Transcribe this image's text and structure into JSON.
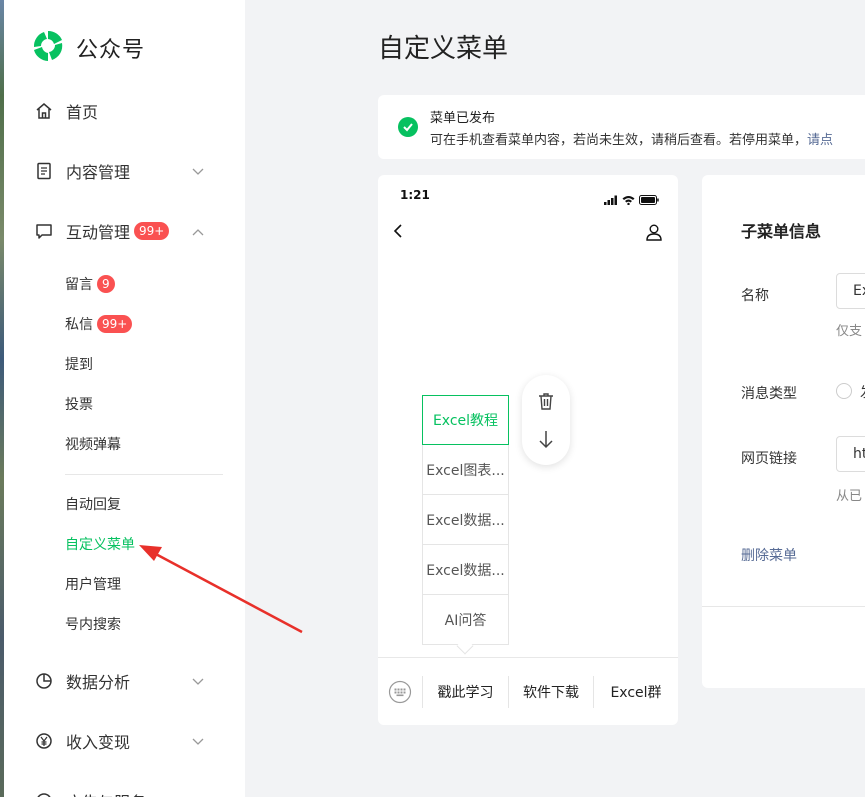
{
  "brand": {
    "name": "公众号",
    "accent": "#07c160"
  },
  "sidebar": {
    "items": [
      {
        "label": "首页",
        "icon": "home-icon"
      },
      {
        "label": "内容管理",
        "icon": "document-icon",
        "expanded": false
      },
      {
        "label": "互动管理",
        "icon": "chat-icon",
        "badge": "99+",
        "expanded": true
      },
      {
        "label": "数据分析",
        "icon": "chart-icon",
        "expanded": false
      },
      {
        "label": "收入变现",
        "icon": "yen-icon",
        "expanded": false
      },
      {
        "label": "广告与服务",
        "icon": "service-icon"
      }
    ],
    "subitems": [
      {
        "label": "留言",
        "badge": "9"
      },
      {
        "label": "私信",
        "badge": "99+"
      },
      {
        "label": "提到"
      },
      {
        "label": "投票"
      },
      {
        "label": "视频弹幕"
      },
      {
        "label": "自动回复"
      },
      {
        "label": "自定义菜单",
        "active": true
      },
      {
        "label": "用户管理"
      },
      {
        "label": "号内搜索"
      }
    ]
  },
  "main": {
    "title": "自定义菜单",
    "notice": {
      "title": "菜单已发布",
      "text": "可在手机查看菜单内容，若尚未生效，请稍后查看。若停用菜单，",
      "link": "请点"
    }
  },
  "phone": {
    "time": "1:21",
    "submenu": [
      "Excel教程",
      "Excel图表...",
      "Excel数据...",
      "Excel数据...",
      "AI问答"
    ],
    "selected_submenu": 0,
    "menu": [
      "戳此学习",
      "软件下载",
      "Excel群"
    ]
  },
  "panel": {
    "title": "子菜单信息",
    "name_label": "名称",
    "name_value": "Ex",
    "name_hint": "仅支",
    "msg_type_label": "消息类型",
    "msg_type_option": "发",
    "url_label": "网页链接",
    "url_value": "ht",
    "url_hint": "从已",
    "delete_label": "删除菜单"
  },
  "colors": {
    "link": "#576b95",
    "badge": "#fa5151",
    "arrow": "#e8302a"
  }
}
